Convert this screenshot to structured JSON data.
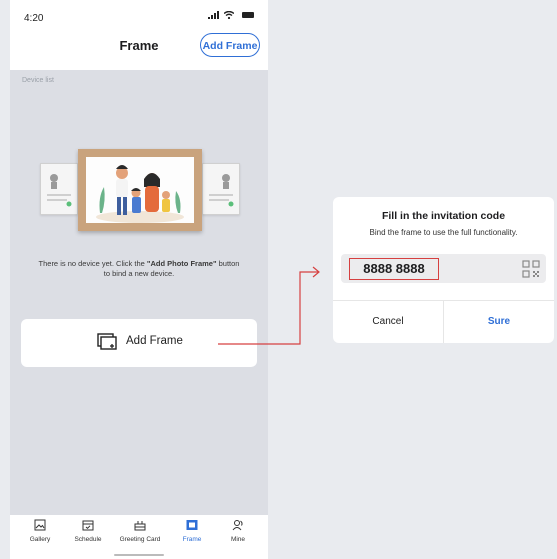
{
  "status_bar": {
    "time": "4:20"
  },
  "header": {
    "title": "Frame",
    "add_frame_button": "Add Frame"
  },
  "device_list_label": "Device list",
  "empty_state": {
    "text_before": "There is no device yet. Click the ",
    "text_bold": "\"Add Photo Frame\"",
    "text_after": " button to bind a new device."
  },
  "add_frame_card": {
    "label": "Add Frame",
    "icon": "add-frame-icon"
  },
  "tabs": [
    {
      "label": "Gallery",
      "icon": "gallery-icon",
      "active": false
    },
    {
      "label": "Schedule",
      "icon": "schedule-icon",
      "active": false
    },
    {
      "label": "Greeting Card",
      "icon": "greeting-card-icon",
      "active": false
    },
    {
      "label": "Frame",
      "icon": "frame-icon",
      "active": true
    },
    {
      "label": "Mine",
      "icon": "mine-icon",
      "active": false
    }
  ],
  "dialog": {
    "title": "Fill in the invitation code",
    "subtitle": "Bind the frame to use the full functionality.",
    "code_value": "8888 8888",
    "cancel_label": "Cancel",
    "sure_label": "Sure"
  },
  "colors": {
    "accent": "#2f6fd6",
    "highlight": "#d64040",
    "background": "#dcdee4"
  }
}
